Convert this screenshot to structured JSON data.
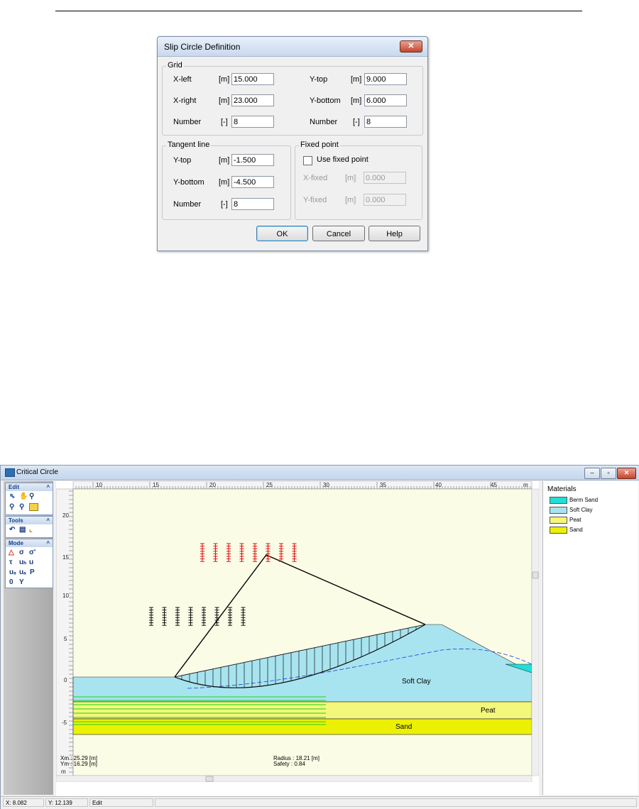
{
  "dialog": {
    "title": "Slip Circle Definition",
    "close_glyph": "✕",
    "grid": {
      "title": "Grid",
      "x_left": {
        "label": "X-left",
        "unit": "[m]",
        "value": "15.000"
      },
      "x_right": {
        "label": "X-right",
        "unit": "[m]",
        "value": "23.000"
      },
      "number_left": {
        "label": "Number",
        "unit": "[-]",
        "value": "8"
      },
      "y_top": {
        "label": "Y-top",
        "unit": "[m]",
        "value": "9.000"
      },
      "y_bottom": {
        "label": "Y-bottom",
        "unit": "[m]",
        "value": "6.000"
      },
      "number_right": {
        "label": "Number",
        "unit": "[-]",
        "value": "8"
      }
    },
    "tangent": {
      "title": "Tangent line",
      "y_top": {
        "label": "Y-top",
        "unit": "[m]",
        "value": "-1.500"
      },
      "y_bottom": {
        "label": "Y-bottom",
        "unit": "[m]",
        "value": "-4.500"
      },
      "number": {
        "label": "Number",
        "unit": "[-]",
        "value": "8"
      }
    },
    "fixed": {
      "title": "Fixed point",
      "use_label": "Use fixed point",
      "checked": false,
      "x_fixed": {
        "label": "X-fixed",
        "unit": "[m]",
        "value": "0.000"
      },
      "y_fixed": {
        "label": "Y-fixed",
        "unit": "[m]",
        "value": "0.000"
      }
    },
    "buttons": {
      "ok": "OK",
      "cancel": "Cancel",
      "help": "Help"
    }
  },
  "app": {
    "title": "Critical Circle",
    "window_buttons": {
      "minimize": "–",
      "restore": "▫",
      "close": "✕"
    },
    "toolbar": {
      "edit": "Edit",
      "tools": "Tools",
      "mode": "Mode",
      "collapse_glyph": "^",
      "mode_glyphs": [
        "σ",
        "σ'",
        "τ",
        "uₕ",
        "u",
        "uₛ",
        "uₐ",
        "P",
        "0",
        "Y"
      ]
    },
    "ruler_x": {
      "labels": [
        "10",
        "15",
        "20",
        "25",
        "30",
        "35",
        "40",
        "45"
      ],
      "unit": "m"
    },
    "ruler_y": {
      "labels": [
        "20",
        "15",
        "10",
        "5",
        "0",
        "-5"
      ],
      "unit": "m"
    },
    "layer_labels": {
      "soft_clay": "Soft Clay",
      "peat": "Peat",
      "sand": "Sand"
    },
    "info": {
      "xm": "Xm : 25.29 [m]",
      "ym": "Ym : 16.29 [m]",
      "radius": "Radius : 18.21 [m]",
      "safety": "Safety : 0.84"
    },
    "materials": {
      "title": "Materials",
      "items": [
        {
          "label": "Berm Sand",
          "color": "#1ee0d9"
        },
        {
          "label": "Soft Clay",
          "color": "#a8e4ef"
        },
        {
          "label": "Peat",
          "color": "#f3f77a"
        },
        {
          "label": "Sand",
          "color": "#ecf104"
        }
      ]
    },
    "status": {
      "x": "X: 8.082",
      "y": "Y: 12.139",
      "mode": "Edit"
    }
  }
}
